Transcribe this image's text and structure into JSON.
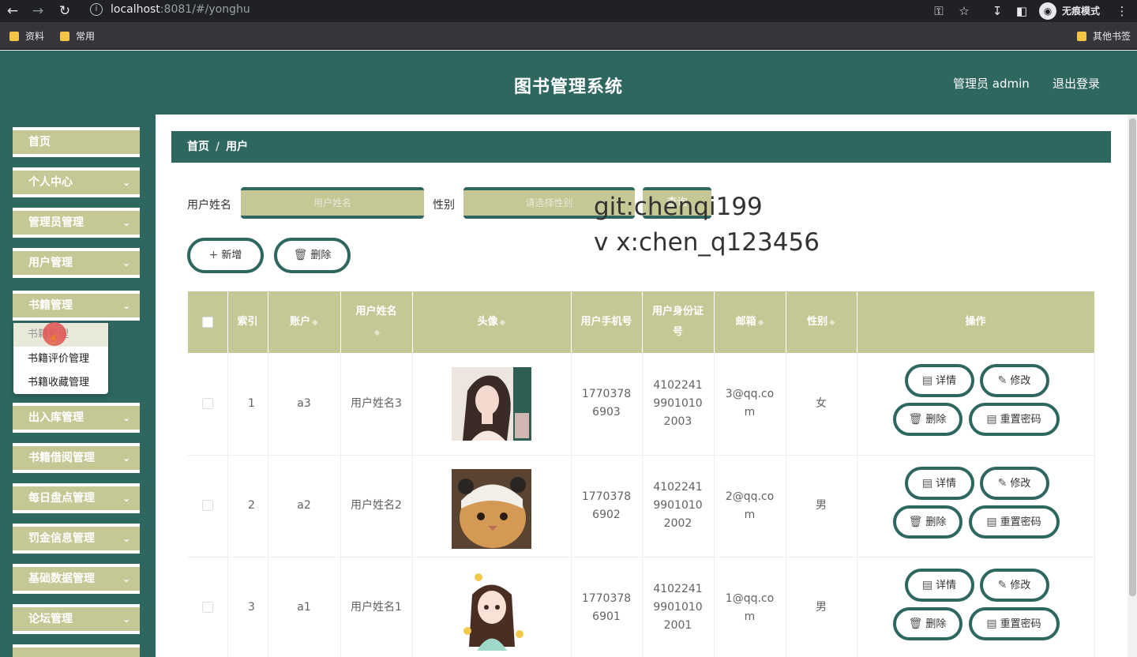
{
  "browser": {
    "url_host": "localhost",
    "url_port_path": ":8081/#/yonghu",
    "incognito_label": "无痕模式",
    "bookmarks": [
      "资料",
      "常用"
    ],
    "other_bookmarks": "其他书签"
  },
  "header": {
    "title": "图书管理系统",
    "admin_label": "管理员 admin",
    "logout_label": "退出登录"
  },
  "sidebar": {
    "items": [
      {
        "label": "首页",
        "has_chevron": false
      },
      {
        "label": "个人中心",
        "has_chevron": true
      },
      {
        "label": "管理员管理",
        "has_chevron": true
      },
      {
        "label": "用户管理",
        "has_chevron": true
      },
      {
        "label": "书籍管理",
        "has_chevron": true
      },
      {
        "label": "出入库管理",
        "has_chevron": true
      },
      {
        "label": "书籍借阅管理",
        "has_chevron": true
      },
      {
        "label": "每日盘点管理",
        "has_chevron": true
      },
      {
        "label": "罚金信息管理",
        "has_chevron": true
      },
      {
        "label": "基础数据管理",
        "has_chevron": true
      },
      {
        "label": "论坛管理",
        "has_chevron": true
      }
    ],
    "submenu": [
      {
        "label": "书籍管理",
        "active": true
      },
      {
        "label": "书籍评价管理",
        "active": false
      },
      {
        "label": "书籍收藏管理",
        "active": false
      }
    ]
  },
  "breadcrumb": {
    "home": "首页",
    "sep": "/",
    "current": "用户"
  },
  "search": {
    "name_label": "用户姓名",
    "name_placeholder": "用户姓名",
    "gender_label": "性别",
    "gender_placeholder": "请选择性别",
    "button_label": "查询"
  },
  "watermark": {
    "line1": "git:chenqi199",
    "line2": "v x:chen_q123456"
  },
  "actions": {
    "add_label": "新增",
    "delete_label": "删除"
  },
  "table": {
    "headers": [
      "索引",
      "账户",
      "用户姓名",
      "头像",
      "用户手机号",
      "用户身份证号",
      "邮箱",
      "性别",
      "操作"
    ],
    "rows": [
      {
        "index": "1",
        "account": "a3",
        "name": "用户姓名3",
        "phone": "17703786903",
        "id_card": "410224199010102003",
        "email": "3@qq.com",
        "gender": "女"
      },
      {
        "index": "2",
        "account": "a2",
        "name": "用户姓名2",
        "phone": "17703786902",
        "id_card": "410224199010102002",
        "email": "2@qq.com",
        "gender": "男"
      },
      {
        "index": "3",
        "account": "a1",
        "name": "用户姓名1",
        "phone": "17703786901",
        "id_card": "410224199010102001",
        "email": "1@qq.com",
        "gender": "男"
      }
    ],
    "row_actions": {
      "detail": "详情",
      "edit": "修改",
      "delete": "删除",
      "reset_password": "重置密码"
    }
  },
  "colors": {
    "primary": "#2e6660",
    "accent": "#c5c795"
  }
}
